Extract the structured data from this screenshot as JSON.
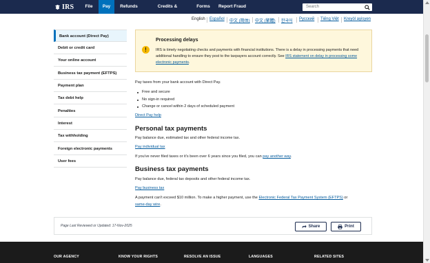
{
  "header": {
    "logo_text": "IRS",
    "nav": [
      {
        "label": "File"
      },
      {
        "label": "Pay"
      },
      {
        "label": "Refunds"
      },
      {
        "label": "Credits & Deductions"
      },
      {
        "label": "Forms"
      },
      {
        "label": "Report Fraud"
      }
    ],
    "search_placeholder": "Search",
    "brand_color": "#1b2a4e",
    "active_color": "#0071bc"
  },
  "languages": [
    "English",
    "Español",
    "中文 (简体)",
    "中文 (繁體)",
    "한국어",
    "Русский",
    "Tiếng Việt",
    "Kreyòl ayisyen"
  ],
  "sidebar": {
    "items": [
      {
        "label": "Bank account (Direct Pay)"
      },
      {
        "label": "Debit or credit card"
      },
      {
        "label": "Your online account"
      },
      {
        "label": "Business tax payment (EFTPS)"
      },
      {
        "label": "Payment plan"
      },
      {
        "label": "Tax debt help"
      },
      {
        "label": "Penalties"
      },
      {
        "label": "Interest"
      },
      {
        "label": "Tax withholding"
      },
      {
        "label": "Foreign electronic payments"
      },
      {
        "label": "User fees"
      }
    ]
  },
  "alert": {
    "icon": "warning-icon",
    "title": "Processing delays",
    "body_text": "IRS is timely negotiating checks and payments with financial institutions. There is a delay in processing payments that need additional handling to ensure they post to the taxpayers account correctly. See ",
    "link_text": "IRS statement on delay in processing some electronic payments",
    "body_end": "."
  },
  "main": {
    "intro": "Pay taxes from your bank account with Direct Pay.",
    "bullets": [
      "Free and secure",
      "No sign-in required",
      "Change or cancel within 2 days of scheduled payment"
    ],
    "direct_pay_help": "Direct Pay help",
    "personal": {
      "heading": "Personal tax payments",
      "desc": "Pay balance due, estimated tax and other federal income tax.",
      "link": "Pay individual tax",
      "note_text": "If you've never filed taxes or it's been over 6 years since you filed, you can ",
      "note_link": "pay another way",
      "note_end": "."
    },
    "business": {
      "heading": "Business tax payments",
      "desc": "Pay balance due, federal tax deposits and other federal income tax.",
      "link": "Pay business tax",
      "note_text": "A payment can't exceed $10 million. To make a higher payment, use the ",
      "note_link1": "Electronic Federal Tax Payment System (EFTPS)",
      "note_mid": " or",
      "note_link2": "same-day wire",
      "note_end": "."
    }
  },
  "review": {
    "text": "Page Last Reviewed or Updated: 17-Nov-2025",
    "share_label": "Share",
    "print_label": "Print"
  },
  "footer": {
    "headings": [
      "OUR AGENCY",
      "KNOW YOUR RIGHTS",
      "RESOLVE AN ISSUE",
      "LANGUAGES",
      "RELATED SITES"
    ]
  }
}
